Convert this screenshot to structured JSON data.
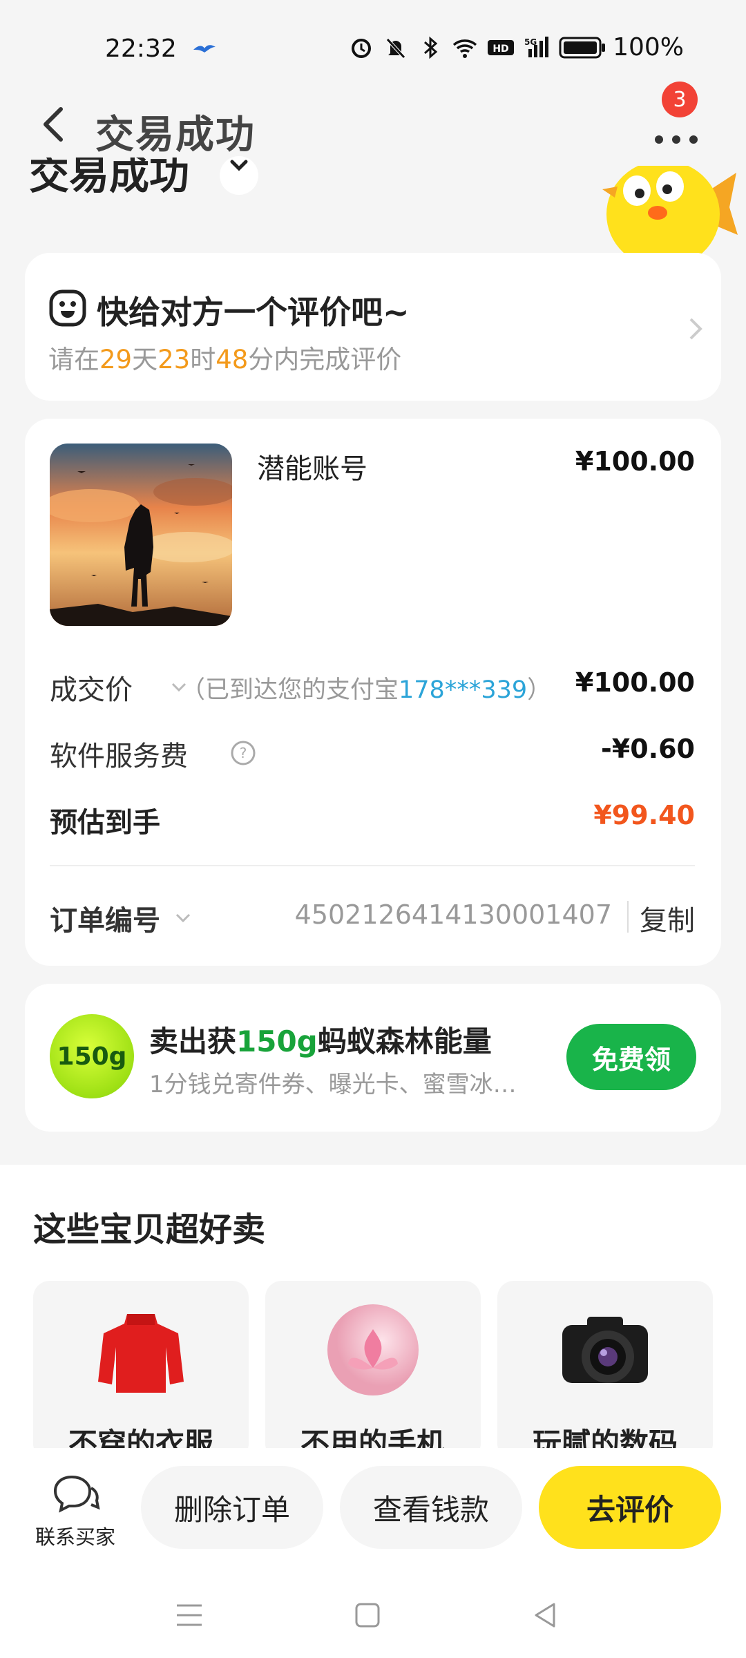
{
  "status_bar": {
    "time": "22:32",
    "battery": "100%"
  },
  "header": {
    "title": "交易成功",
    "badge": "3",
    "scrolled_title": "交易成功"
  },
  "review_card": {
    "title": "快给对方一个评价吧~",
    "sub_prefix": "请在",
    "days": "29",
    "days_unit": "天",
    "hours": "23",
    "hours_unit": "时",
    "minutes": "48",
    "sub_suffix": "分内完成评价"
  },
  "order_card": {
    "product_name": "潜能账号",
    "product_price": "¥100.00",
    "deal_label": "成交价",
    "deal_note_prefix": "（已到达您的支付宝",
    "deal_note_account": "178***339",
    "deal_note_suffix": "）",
    "deal_value": "¥100.00",
    "fee_label": "软件服务费",
    "fee_value": "-¥0.60",
    "net_label": "预估到手",
    "net_value": "¥99.40",
    "order_id_label": "订单编号",
    "order_id": "4502126414130001407",
    "copy_label": "复制"
  },
  "energy_card": {
    "ball_label": "150g",
    "title_prefix": "卖出获",
    "title_highlight": "150g",
    "title_suffix": "蚂蚁森林能量",
    "subtitle": "1分钱兑寄件券、曝光卡、蜜雪冰…",
    "button": "免费领"
  },
  "recommend": {
    "title": "这些宝贝超好卖",
    "items": [
      {
        "label": "不穿的衣服"
      },
      {
        "label": "不用的手机"
      },
      {
        "label": "玩腻的数码"
      }
    ]
  },
  "bottom_bar": {
    "contact_label": "联系买家",
    "delete_label": "删除订单",
    "view_label": "查看钱款",
    "rate_label": "去评价"
  },
  "colors": {
    "accent_yellow": "#ffe11c",
    "energy_green": "#19b44a",
    "countdown_orange": "#f39a1b",
    "net_orange": "#f2561d",
    "account_blue": "#2ba4d8"
  }
}
